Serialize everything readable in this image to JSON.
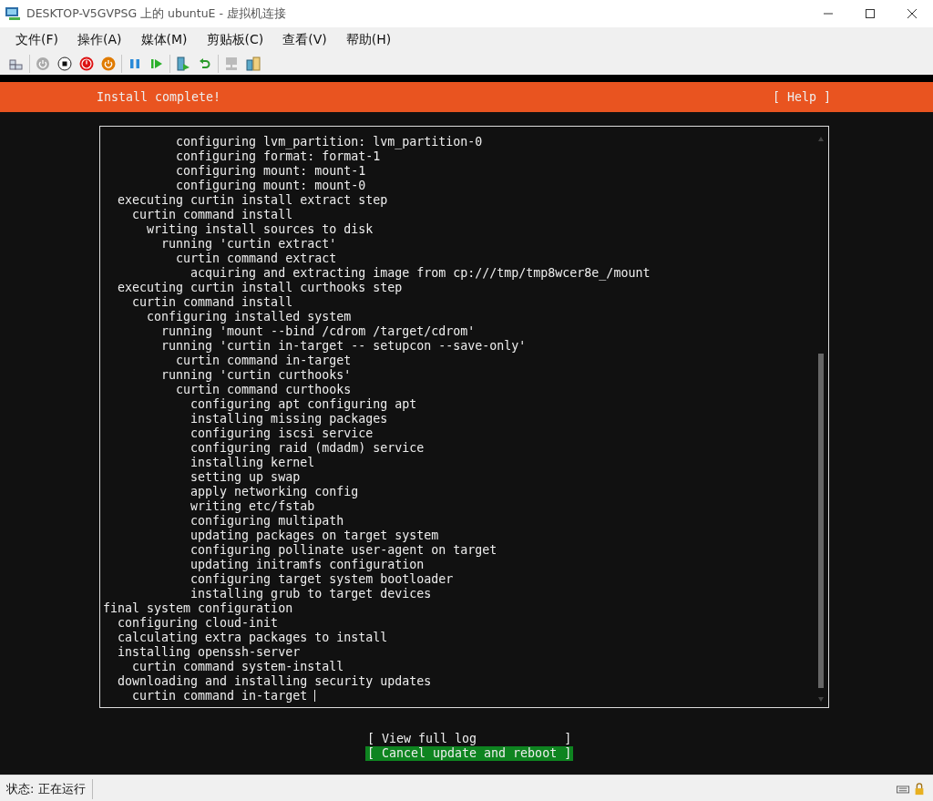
{
  "window": {
    "title": "DESKTOP-V5GVPSG 上的 ubuntuE - 虚拟机连接"
  },
  "menu": [
    "文件(F)",
    "操作(A)",
    "媒体(M)",
    "剪贴板(C)",
    "查看(V)",
    "帮助(H)"
  ],
  "installer": {
    "header": "Install complete!",
    "help": "[ Help ]",
    "log_lines": [
      "          configuring lvm_partition: lvm_partition-0",
      "          configuring format: format-1",
      "          configuring mount: mount-1",
      "          configuring mount: mount-0",
      "  executing curtin install extract step",
      "    curtin command install",
      "      writing install sources to disk",
      "        running 'curtin extract'",
      "          curtin command extract",
      "            acquiring and extracting image from cp:///tmp/tmp8wcer8e_/mount",
      "  executing curtin install curthooks step",
      "    curtin command install",
      "      configuring installed system",
      "        running 'mount --bind /cdrom /target/cdrom'",
      "        running 'curtin in-target -- setupcon --save-only'",
      "          curtin command in-target",
      "        running 'curtin curthooks'",
      "          curtin command curthooks",
      "            configuring apt configuring apt",
      "            installing missing packages",
      "            configuring iscsi service",
      "            configuring raid (mdadm) service",
      "            installing kernel",
      "            setting up swap",
      "            apply networking config",
      "            writing etc/fstab",
      "            configuring multipath",
      "            updating packages on target system",
      "            configuring pollinate user-agent on target",
      "            updating initramfs configuration",
      "            configuring target system bootloader",
      "            installing grub to target devices",
      "final system configuration",
      "  configuring cloud-init",
      "  calculating extra packages to install",
      "  installing openssh-server",
      "    curtin command system-install",
      "  downloading and installing security updates",
      "    curtin command in-target"
    ],
    "buttons": [
      {
        "label": "[ View full log            ]",
        "selected": false
      },
      {
        "label": "[ Cancel update and reboot ]",
        "selected": true
      }
    ]
  },
  "status_bar": {
    "status": "状态: 正在运行"
  }
}
